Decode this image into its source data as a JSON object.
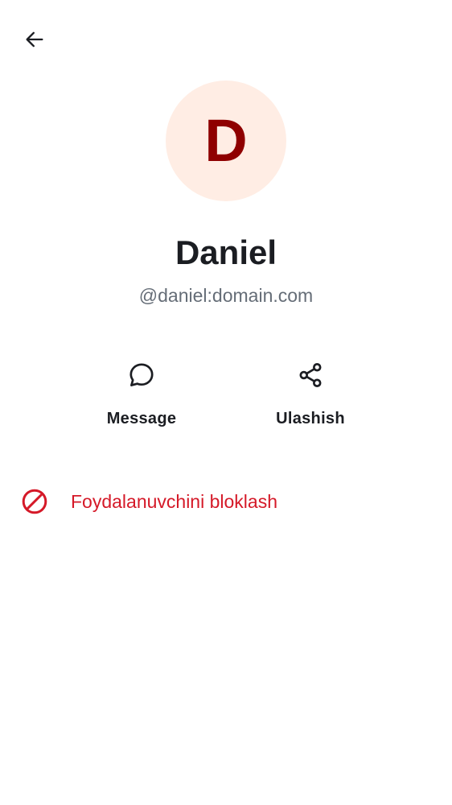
{
  "header": {
    "back_icon": "arrow-left-icon"
  },
  "profile": {
    "avatar_initial": "D",
    "display_name": "Daniel",
    "user_id": "@daniel:domain.com"
  },
  "actions": {
    "message": {
      "label": "Message",
      "icon": "chat-bubble-icon"
    },
    "share": {
      "label": "Ulashish",
      "icon": "share-icon"
    }
  },
  "block": {
    "label": "Foydalanuvchini bloklash",
    "icon": "block-icon"
  },
  "colors": {
    "avatar_background": "#ffede4",
    "avatar_text": "#8f0000",
    "primary_text": "#1b1d22",
    "secondary_text": "#656d77",
    "critical": "#d51928"
  }
}
